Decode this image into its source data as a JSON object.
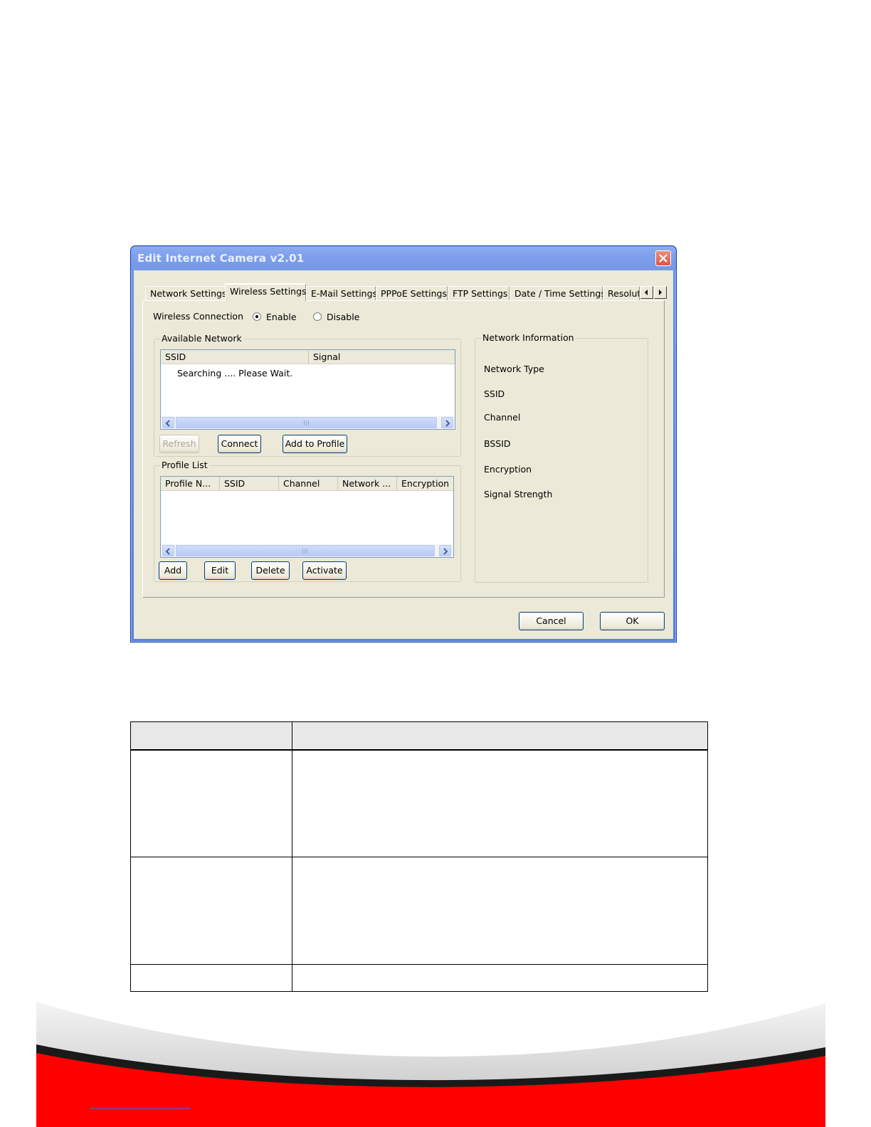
{
  "window": {
    "title": "Edit Internet Camera v2.01"
  },
  "tabs": [
    {
      "label": "Network Settings"
    },
    {
      "label": "Wireless Settings"
    },
    {
      "label": "E-Mail Settings"
    },
    {
      "label": "PPPoE Settings"
    },
    {
      "label": "FTP Settings"
    },
    {
      "label": "Date / Time Settings"
    },
    {
      "label": "Resolut"
    }
  ],
  "wireless_connection": {
    "label": "Wireless Connection",
    "enable_label": "Enable",
    "disable_label": "Disable",
    "selected": "Enable"
  },
  "available_network": {
    "legend": "Available Network",
    "columns": [
      "SSID",
      "Signal"
    ],
    "status_text": "Searching .... Please Wait.",
    "refresh_label": "Refresh",
    "connect_label": "Connect",
    "add_to_profile_label": "Add to Profile"
  },
  "profile_list": {
    "legend": "Profile List",
    "columns": [
      "Profile N...",
      "SSID",
      "Channel",
      "Network ...",
      "Encryption"
    ],
    "add_label": "Add",
    "edit_label": "Edit",
    "delete_label": "Delete",
    "activate_label": "Activate"
  },
  "network_information": {
    "legend": "Network Information",
    "fields": [
      "Network Type",
      "SSID",
      "Channel",
      "BSSID",
      "Encryption",
      "Signal Strength"
    ]
  },
  "footer_buttons": {
    "cancel_label": "Cancel",
    "ok_label": "OK"
  },
  "colors": {
    "titlebar": "#7ea0ec",
    "client_bg": "#ece9d8",
    "close_button": "#d65a44",
    "footer_red": "#ff0000"
  }
}
